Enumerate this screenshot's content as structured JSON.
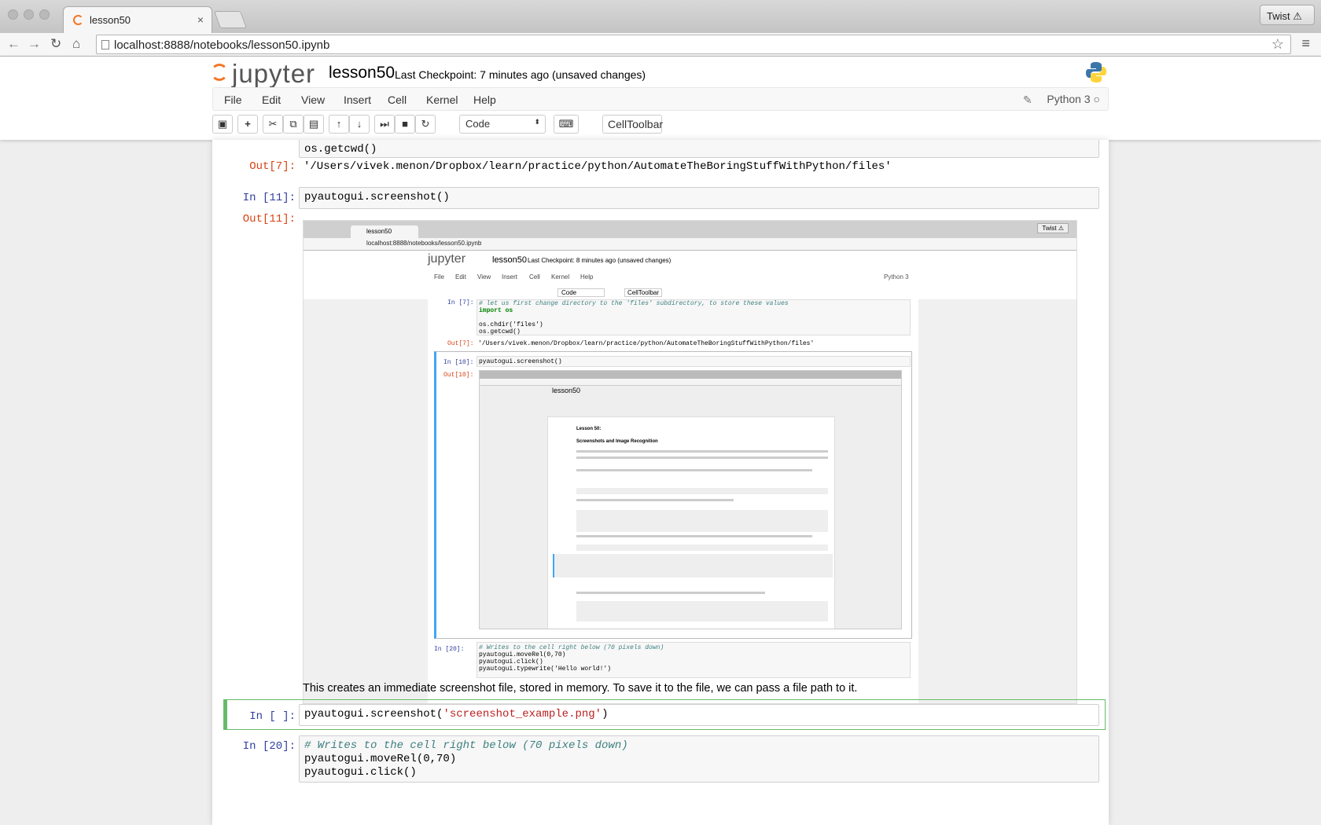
{
  "browser": {
    "tab_title": "lesson50",
    "tab_close": "×",
    "profile": "Twist ⚠",
    "url": "localhost:8888/notebooks/lesson50.ipynb"
  },
  "jupyter": {
    "logo_text": "jupyter",
    "notebook_name": "lesson50",
    "checkpoint": "Last Checkpoint: 7 minutes ago (unsaved changes)",
    "menu": [
      "File",
      "Edit",
      "View",
      "Insert",
      "Cell",
      "Kernel",
      "Help"
    ],
    "kernel": "Python 3",
    "cell_type": "Code",
    "celltoolbar": "CellToolbar"
  },
  "cells": {
    "c7_tail": "os.getcwd()",
    "out7_prompt": "Out[7]:",
    "out7": "'/Users/vivek.menon/Dropbox/learn/practice/python/AutomateTheBoringStuffWithPython/files'",
    "in11_prompt": "In [11]:",
    "in11": "pyautogui.screenshot()",
    "out11_prompt": "Out[11]:",
    "markdown": "This creates an immediate screenshot file, stored in memory. To save it to the file, we can pass a file path to it.",
    "active_prompt": "In [ ]:",
    "active_code_a": "pyautogui.screenshot(",
    "active_code_str": "'screenshot_example.png'",
    "active_code_b": ")",
    "in20_prompt": "In [20]:",
    "in20_comment": "# Writes to the cell right below (70 pixels down)",
    "in20_line2": "pyautogui.moveRel(0,70)",
    "in20_line3": "pyautogui.click()"
  },
  "shot": {
    "tab": "lesson50",
    "twist": "Twist ⚠",
    "url": "localhost:8888/notebooks/lesson50.ipynb",
    "logo": "jupyter",
    "name": "lesson50",
    "checkpoint": "Last Checkpoint: 8 minutes ago (unsaved changes)",
    "menu": [
      "File",
      "Edit",
      "View",
      "Insert",
      "Cell",
      "Kernel",
      "Help"
    ],
    "kernel": "Python 3",
    "cell_type": "Code",
    "celltoolbar": "CellToolbar",
    "in7_prompt": "In [7]:",
    "l1": "# let us first change directory to the 'files' subdirectory, to store these values",
    "l2": "import os",
    "l3": "os.chdir('files')",
    "l4": "os.getcwd()",
    "out7_prompt": "Out[7]:",
    "out7": "'/Users/vivek.menon/Dropbox/learn/practice/python/AutomateTheBoringStuffWithPython/files'",
    "in10_prompt": "In [10]:",
    "in10": "pyautogui.screenshot()",
    "out10_prompt": "Out[10]:",
    "in20_prompt": "In [20]:",
    "in20_l1": "# Writes to the cell right below (70 pixels down)",
    "in20_l2": "pyautogui.moveRel(0,70)",
    "in20_l3": "pyautogui.click()",
    "in20_l4": "pyautogui.typewrite('Hello world!')"
  },
  "shot2": {
    "name": "lesson50",
    "title": "Lesson 50:",
    "subtitle": "Screenshots and Image Recognition"
  }
}
